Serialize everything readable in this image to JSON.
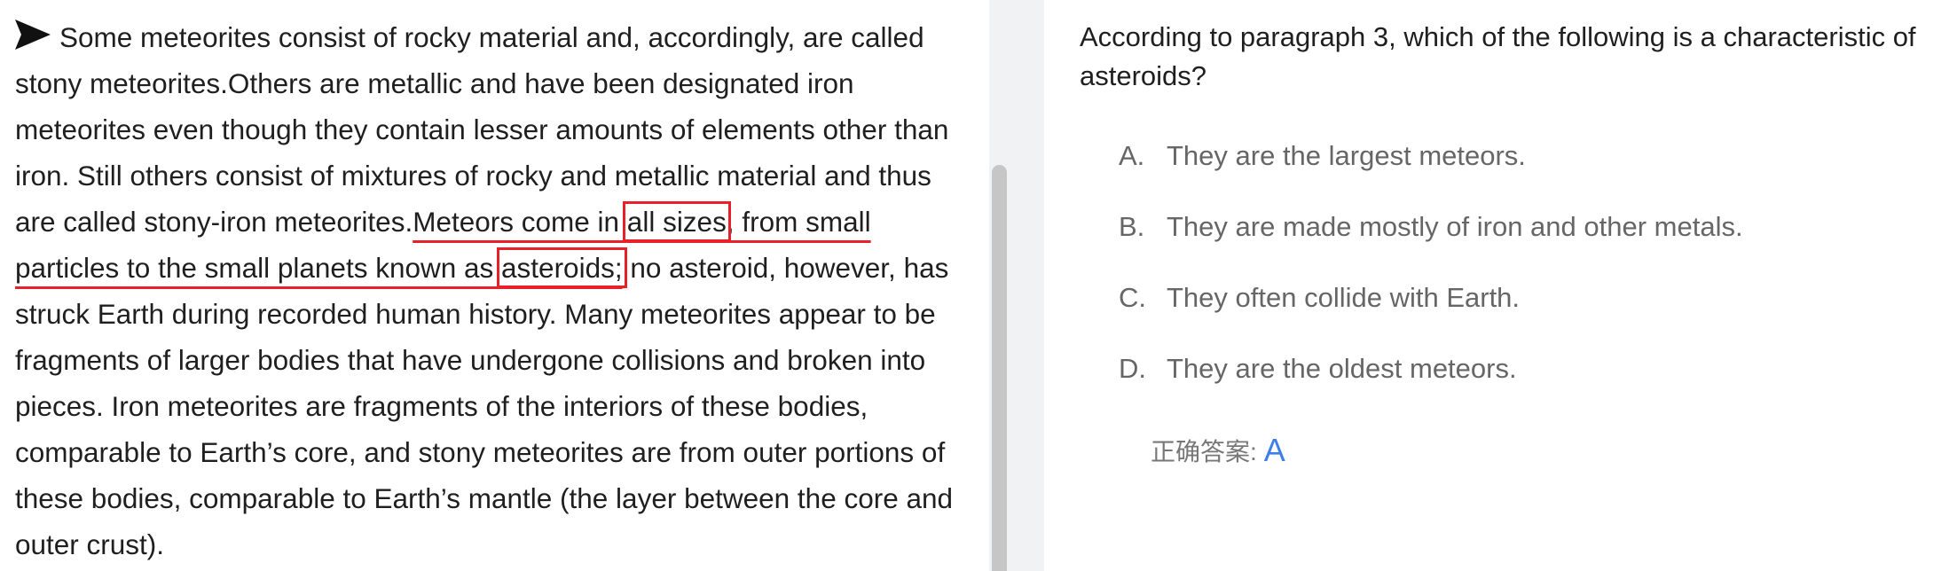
{
  "passage": {
    "arrow_icon": "triangle-right-icon",
    "seg1": "Some meteorites consist of rocky material and, accordingly, are called stony meteorites.Others are metallic and have been designated iron meteorites even though they contain lesser amounts of elements other than iron. Still others consist of mixtures of rocky and metallic material and thus are called stony-iron meteorites.",
    "seg2": "Meteors come in ",
    "seg3": "all sizes",
    "seg4": ", from small particles to the small planets known as ",
    "seg5": "asteroids",
    "seg6": ";",
    "seg7": " no asteroid, however, has struck Earth during recorded human history. Many meteorites appear to be fragments of larger bodies that have undergone collisions and broken into pieces. Iron meteorites are fragments of the interiors of these bodies, comparable to Earth’s core, and stony meteorites are from outer portions of these bodies, comparable to Earth’s mantle (the layer between the core and outer crust).",
    "highlight_color": "#e8202a"
  },
  "question": {
    "text": "According to paragraph 3, which of the following is a characteristic of asteroids?",
    "options": [
      {
        "letter": "A.",
        "text": "They are the largest meteors."
      },
      {
        "letter": "B.",
        "text": "They are made mostly of iron and other metals."
      },
      {
        "letter": "C.",
        "text": "They often collide with Earth."
      },
      {
        "letter": "D.",
        "text": "They are the oldest meteors."
      }
    ]
  },
  "answer": {
    "label": "正确答案:",
    "value": "A",
    "value_color": "#3d7fe6"
  }
}
